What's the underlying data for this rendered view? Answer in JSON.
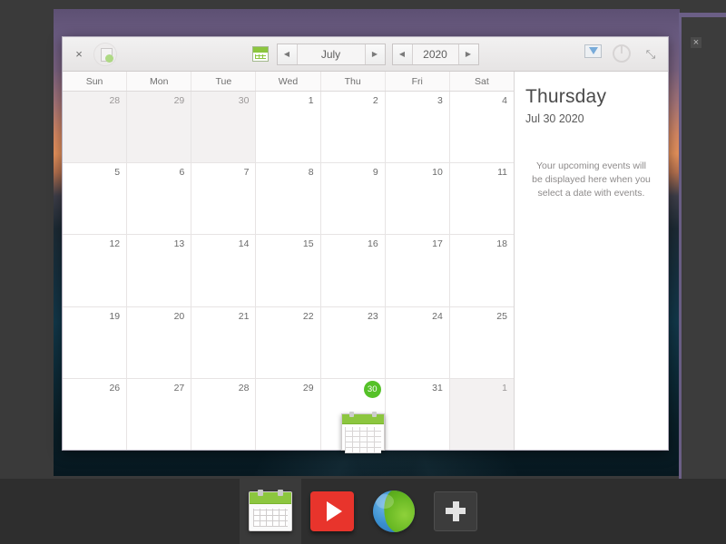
{
  "window": {
    "close_label": "×",
    "toolbar": {
      "prev_month_label": "◀",
      "next_month_label": "▶",
      "prev_year_label": "◀",
      "next_year_label": "▶",
      "month_value": "July",
      "year_value": "2020",
      "import_icon": "import-icon",
      "power_icon": "power-icon",
      "expand_label": "⤡"
    }
  },
  "background_window": {
    "close_label": "×"
  },
  "calendar": {
    "weekdays": [
      "Sun",
      "Mon",
      "Tue",
      "Wed",
      "Thu",
      "Fri",
      "Sat"
    ],
    "weeks": [
      [
        {
          "num": "28",
          "other": true
        },
        {
          "num": "29",
          "other": true
        },
        {
          "num": "30",
          "other": true
        },
        {
          "num": "1",
          "other": false
        },
        {
          "num": "2",
          "other": false
        },
        {
          "num": "3",
          "other": false
        },
        {
          "num": "4",
          "other": false
        }
      ],
      [
        {
          "num": "5",
          "other": false
        },
        {
          "num": "6",
          "other": false
        },
        {
          "num": "7",
          "other": false
        },
        {
          "num": "8",
          "other": false
        },
        {
          "num": "9",
          "other": false
        },
        {
          "num": "10",
          "other": false
        },
        {
          "num": "11",
          "other": false
        }
      ],
      [
        {
          "num": "12",
          "other": false
        },
        {
          "num": "13",
          "other": false
        },
        {
          "num": "14",
          "other": false
        },
        {
          "num": "15",
          "other": false
        },
        {
          "num": "16",
          "other": false
        },
        {
          "num": "17",
          "other": false
        },
        {
          "num": "18",
          "other": false
        }
      ],
      [
        {
          "num": "19",
          "other": false
        },
        {
          "num": "20",
          "other": false
        },
        {
          "num": "21",
          "other": false
        },
        {
          "num": "22",
          "other": false
        },
        {
          "num": "23",
          "other": false
        },
        {
          "num": "24",
          "other": false
        },
        {
          "num": "25",
          "other": false
        }
      ],
      [
        {
          "num": "26",
          "other": false
        },
        {
          "num": "27",
          "other": false
        },
        {
          "num": "28",
          "other": false
        },
        {
          "num": "29",
          "other": false
        },
        {
          "num": "30",
          "other": false,
          "today": true
        },
        {
          "num": "31",
          "other": false
        },
        {
          "num": "1",
          "other": true
        }
      ]
    ],
    "today_highlight_color": "#55c128"
  },
  "side_panel": {
    "day_name": "Thursday",
    "date": "Jul 30 2020",
    "empty_message": "Your upcoming events will be displayed here when you select a date with events."
  },
  "dock": {
    "items": [
      {
        "name": "calendar",
        "label": "Calendar",
        "active": true
      },
      {
        "name": "video",
        "label": "Video Player",
        "active": false
      },
      {
        "name": "browser",
        "label": "Web Browser",
        "active": false
      },
      {
        "name": "add",
        "label": "Add Application",
        "active": false
      }
    ]
  }
}
